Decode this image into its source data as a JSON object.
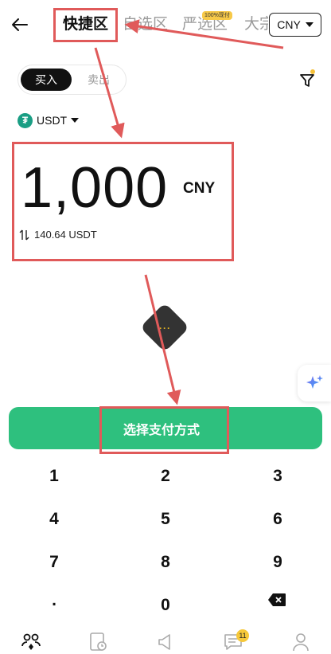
{
  "header": {
    "tabs": [
      {
        "label": "快捷区",
        "active": true
      },
      {
        "label": "自选区",
        "active": false
      },
      {
        "label": "严选区",
        "active": false
      },
      {
        "label": "大宗区",
        "active": false
      }
    ],
    "strict_badge": "100%现付",
    "currency": "CNY"
  },
  "mode_toggle": {
    "buy": "买入",
    "sell": "卖出"
  },
  "coin": {
    "symbol": "USDT",
    "icon": "tether-icon"
  },
  "amount": {
    "value": "1,000",
    "currency": "CNY",
    "converted": "140.64 USDT"
  },
  "loader_dots": "···",
  "action_button": {
    "label": "选择支付方式",
    "color": "#2ec07e"
  },
  "keypad": {
    "keys": [
      "1",
      "2",
      "3",
      "4",
      "5",
      "6",
      "7",
      "8",
      "9",
      ".",
      "0"
    ],
    "backspace": "backspace-icon"
  },
  "bottom_nav": {
    "items": [
      "p2p-icon",
      "orders-icon",
      "ads-icon",
      "chat-icon",
      "profile-icon"
    ],
    "chat_badge": "11"
  },
  "colors": {
    "accent": "#2ec07e",
    "annotation": "#e05a5a",
    "badge": "#f6c83a"
  }
}
